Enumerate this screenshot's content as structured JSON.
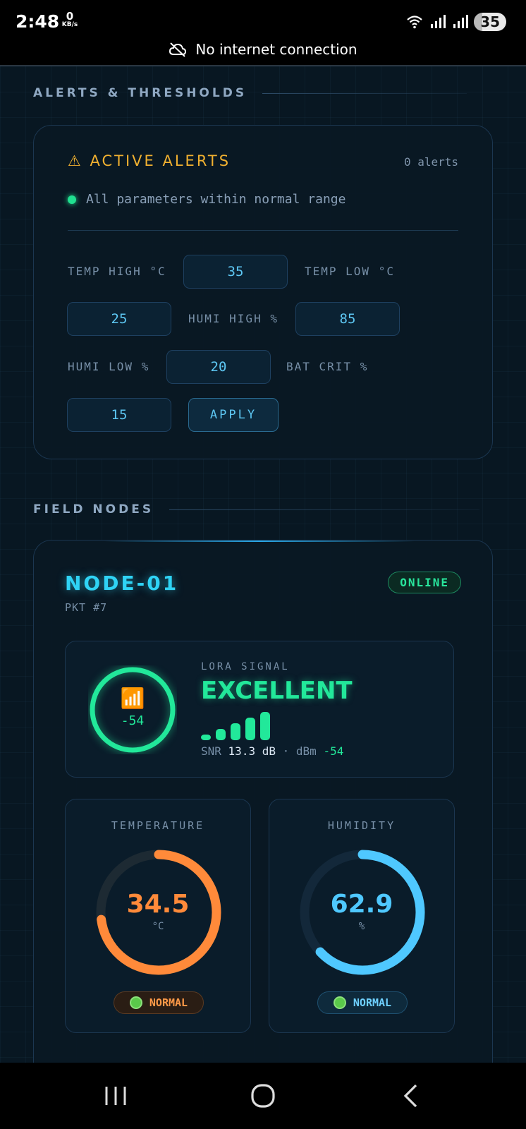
{
  "status_bar": {
    "time": "2:48",
    "net_speed_value": "0",
    "net_speed_unit": "KB/s",
    "battery": "35",
    "connection_text": "No internet connection"
  },
  "alerts_section": {
    "title": "ALERTS & THRESHOLDS",
    "active_title": "⚠ ACTIVE ALERTS",
    "count": "0 alerts",
    "ok_message": "All parameters within normal range",
    "thresholds": [
      {
        "label": "TEMP HIGH °C",
        "value": "35"
      },
      {
        "label": "TEMP LOW °C",
        "value": "25"
      },
      {
        "label": "HUMI HIGH %",
        "value": "85"
      },
      {
        "label": "HUMI LOW %",
        "value": "20"
      },
      {
        "label": "BAT CRIT %",
        "value": "15"
      }
    ],
    "apply_label": "APPLY"
  },
  "nodes_section": {
    "title": "FIELD NODES",
    "node": {
      "name": "NODE-01",
      "packet": "PKT #7",
      "status": "ONLINE",
      "signal": {
        "label": "LORA SIGNAL",
        "quality": "EXCELLENT",
        "icon": "📶",
        "rssi": "-54",
        "bars_active": 5,
        "bars_total": 5,
        "snr_label": "SNR",
        "snr_value": "13.3 dB",
        "separator": "·",
        "dbm_label": "dBm",
        "dbm_value": "-54"
      },
      "temperature": {
        "label": "TEMPERATURE",
        "value": "34.5",
        "unit": "°C",
        "fill_fraction": 0.73,
        "status": "NORMAL",
        "color": "#ff8a3a"
      },
      "humidity": {
        "label": "HUMIDITY",
        "value": "62.9",
        "unit": "%",
        "fill_fraction": 0.63,
        "status": "NORMAL",
        "color": "#4fc8ff"
      }
    }
  },
  "colors": {
    "accent_cyan": "#2fd3f5",
    "signal_green": "#22e89a",
    "alert_amber": "#f0b030"
  }
}
